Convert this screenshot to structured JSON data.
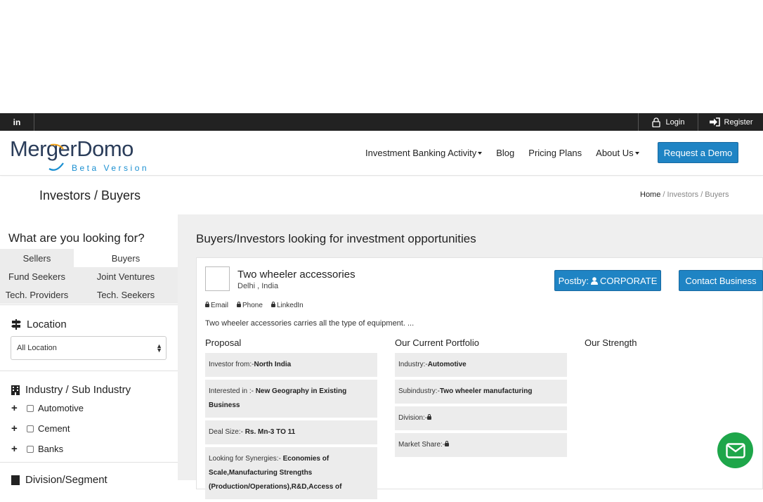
{
  "topbar": {
    "linkedin": "in",
    "login": "Login",
    "register": "Register"
  },
  "nav": {
    "logo_main": "MergerDomo",
    "logo_sub": "Beta Version",
    "items": [
      "Investment Banking Activity",
      "Blog",
      "Pricing Plans",
      "About Us"
    ],
    "demo_button": "Request a Demo"
  },
  "pagehead": {
    "title": "Investors / Buyers",
    "crumb_home": "Home",
    "crumb_rest": " / Investors / Buyers"
  },
  "sidebar": {
    "question": "What are you looking for?",
    "tabs": [
      [
        "Sellers",
        "Buyers"
      ],
      [
        "Fund Seekers",
        "Joint Ventures"
      ],
      [
        "Tech. Providers",
        "Tech. Seekers"
      ]
    ],
    "location_title": "Location",
    "location_value": "All Location",
    "industry_title": "Industry / Sub Industry",
    "industries": [
      "Automotive",
      "Cement",
      "Banks"
    ],
    "division_title": "Division/Segment"
  },
  "main": {
    "title": "Buyers/Investors looking for investment opportunities",
    "card": {
      "title": "Two wheeler accessories",
      "location": "Delhi , India",
      "post_by": "Postby:",
      "post_type": "CORPORATE",
      "contact_button": "Contact Business",
      "contacts": [
        "Email",
        "Phone",
        "LinkedIn"
      ],
      "description": "Two wheeler accessories carries all the type of equipment. ...",
      "proposal_title": "Proposal",
      "proposal": [
        {
          "k": "Investor from:-",
          "v": "North India"
        },
        {
          "k": "Interested in :- ",
          "v": "New Geography in Existing Business"
        },
        {
          "k": "Deal Size:- ",
          "v": "Rs. Mn-3 TO 11"
        },
        {
          "k": "Looking for Synergies:- ",
          "v": "Economies of Scale,Manufacturing Strengths (Production/Operations),R&D,Access of"
        }
      ],
      "portfolio_title": "Our Current Portfolio",
      "portfolio": [
        {
          "k": "Industry:-",
          "v": "Automotive"
        },
        {
          "k": "Subindustry:-",
          "v": "Two wheeler manufacturing"
        },
        {
          "k": "Division:-",
          "v": ""
        },
        {
          "k": "Market Share:-",
          "v": ""
        }
      ],
      "strength_title": "Our Strength"
    }
  },
  "colors": {
    "primary": "#1f84c4",
    "topbar": "#222222",
    "chat": "#1ea64a",
    "logo_blue": "#1a8fd1",
    "logo_navy": "#2b3d5a"
  },
  "icons": [
    "linkedin-icon",
    "lock-icon",
    "login-icon",
    "user-icon",
    "signpost-icon",
    "building-icon",
    "plus-icon",
    "mail-icon"
  ]
}
